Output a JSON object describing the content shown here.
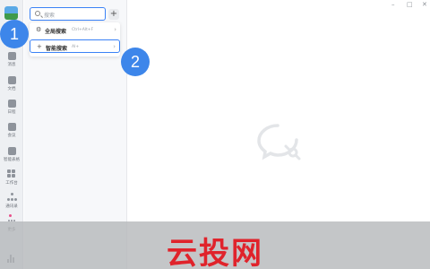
{
  "sidebar": {
    "items": [
      {
        "label": "消息",
        "icon": "message-icon"
      },
      {
        "label": "文档",
        "icon": "document-icon"
      },
      {
        "label": "日程",
        "icon": "calendar-icon"
      },
      {
        "label": "会议",
        "icon": "meeting-icon"
      },
      {
        "label": "智能表格",
        "icon": "smart-sheet-icon"
      },
      {
        "label": "工作台",
        "icon": "workbench-icon"
      },
      {
        "label": "通讯录",
        "icon": "contacts-icon"
      },
      {
        "label": "更多",
        "icon": "more-icon"
      }
    ]
  },
  "search": {
    "placeholder": "搜索"
  },
  "menu": {
    "items": [
      {
        "label": "全局搜索",
        "shortcut": "Ctrl+Alt+F",
        "icon": "global-search-icon"
      },
      {
        "label": "智能搜索",
        "shortcut": "AI+",
        "icon": "ai-search-icon"
      }
    ]
  },
  "steps": [
    "1",
    "2"
  ],
  "window": {
    "minimize": "–",
    "maximize": "□",
    "close": "✕"
  },
  "watermark": "云投网",
  "colors": {
    "accent": "#3b82f6",
    "step": "#3d86ea",
    "watermark": "#e0232b"
  }
}
